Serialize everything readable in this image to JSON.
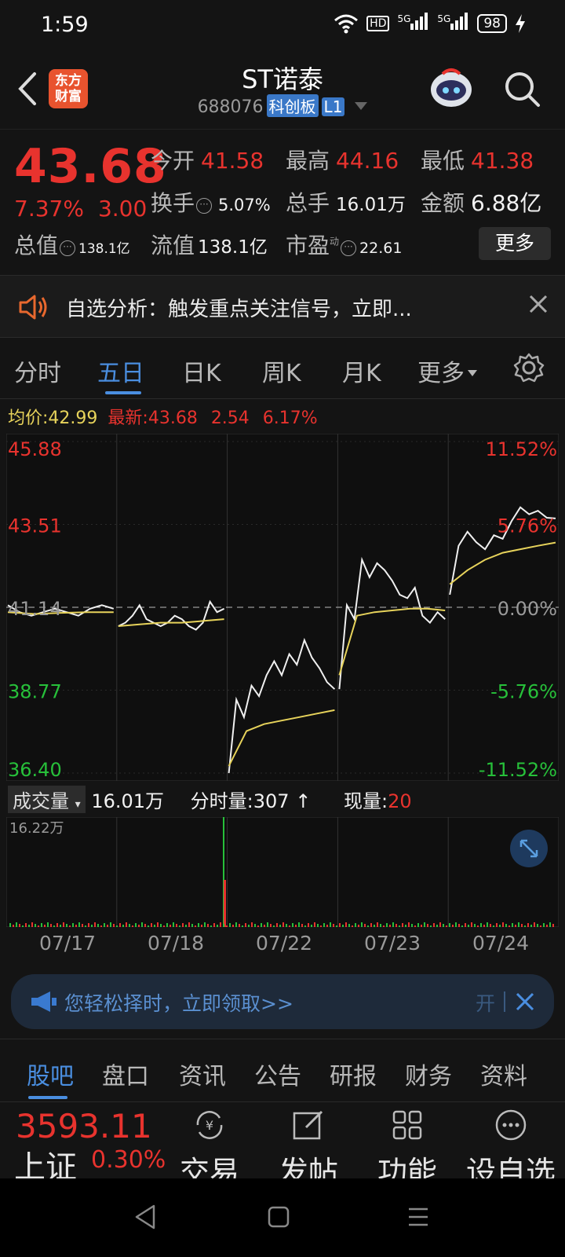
{
  "status_bar": {
    "time": "1:59",
    "hd": "HD",
    "signal1": "5G",
    "signal2": "5G",
    "battery": "98"
  },
  "header": {
    "logo_line1": "东方",
    "logo_line2": "财富",
    "title": "ST诺泰",
    "code": "688076",
    "board_tag": "科创板",
    "level_tag": "L1"
  },
  "quote": {
    "price": "43.68",
    "change_pct": "7.37%",
    "change_amt": "3.00",
    "open_label": "今开",
    "open": "41.58",
    "high_label": "最高",
    "high": "44.16",
    "low_label": "最低",
    "low": "41.38",
    "turnover_label": "换手",
    "turnover": "5.07%",
    "volume_label": "总手",
    "volume": "16.01万",
    "amount_label": "金额",
    "amount": "6.88亿",
    "mktcap_label": "总值",
    "mktcap": "138.1亿",
    "float_label": "流值",
    "float": "138.1亿",
    "pe_label": "市盈",
    "pe_sup": "动",
    "pe": "22.61",
    "more": "更多"
  },
  "notice": {
    "text": "自选分析：触发重点关注信号，立即..."
  },
  "tabs": {
    "items": [
      "分时",
      "五日",
      "日K",
      "周K",
      "月K",
      "更多"
    ],
    "active": "五日"
  },
  "avg_line": {
    "avg_label": "均价:",
    "avg": "42.99",
    "latest_label": "最新:",
    "latest": "43.68",
    "chg": "2.54",
    "pct": "6.17%"
  },
  "chart_data": {
    "type": "line",
    "title": "",
    "y_left_ticks": [
      "45.88",
      "43.51",
      "41.14",
      "38.77",
      "36.40"
    ],
    "y_right_ticks": [
      "11.52%",
      "5.76%",
      "0.00%",
      "-5.76%",
      "-11.52%"
    ],
    "ylim": [
      36.4,
      45.88
    ],
    "prev_close": 41.14,
    "categories": [
      "07/17",
      "07/18",
      "07/22",
      "07/23",
      "07/24"
    ],
    "series": [
      {
        "values": [
          [
            41.2,
            41.0,
            40.9,
            41.0,
            41.1,
            41.0,
            40.9,
            41.1,
            41.2,
            41.1
          ],
          [
            40.6,
            40.7,
            40.9,
            41.2,
            40.8,
            40.7,
            40.6,
            40.7,
            40.9,
            40.8,
            40.6,
            40.5,
            40.7,
            41.3,
            41.0,
            41.1
          ],
          [
            36.4,
            38.5,
            38.0,
            38.9,
            38.6,
            39.2,
            39.6,
            39.2,
            39.8,
            39.5,
            40.2,
            39.7,
            39.4,
            39.0,
            38.8
          ],
          [
            38.8,
            41.2,
            40.8,
            42.5,
            42.0,
            42.4,
            42.2,
            41.9,
            41.5,
            41.4,
            41.7,
            40.9,
            40.7,
            41.0,
            40.8
          ],
          [
            41.5,
            42.9,
            43.3,
            43.0,
            42.8,
            43.2,
            43.1,
            43.6,
            44.0,
            43.8,
            43.9,
            43.7,
            43.68
          ]
        ]
      },
      {
        "values": [
          [
            41.0,
            40.95,
            40.98,
            41.0,
            41.0
          ],
          [
            40.6,
            40.65,
            40.7,
            40.7,
            40.75,
            40.8
          ],
          [
            36.6,
            37.6,
            37.8,
            37.9,
            38.0,
            38.1,
            38.2
          ],
          [
            39.2,
            40.9,
            41.0,
            41.05,
            41.1,
            41.1,
            41.05
          ],
          [
            41.8,
            42.2,
            42.5,
            42.7,
            42.8,
            42.9,
            42.99
          ]
        ]
      }
    ]
  },
  "volume_bar": {
    "selector": "成交量",
    "total": "16.01万",
    "tick_label": "分时量:",
    "tick": "307",
    "now_label": "现量:",
    "now": "20",
    "max_label": "16.22万"
  },
  "banner": {
    "text": "您轻松择时，立即领取>>",
    "open": "开"
  },
  "bottom_tabs": {
    "items": [
      "股吧",
      "盘口",
      "资讯",
      "公告",
      "研报",
      "财务",
      "资料"
    ],
    "active": "股吧"
  },
  "toolbar": {
    "index_value": "3593.11",
    "index_name": "上证",
    "index_pct": "0.30%",
    "items": [
      "交易",
      "发帖",
      "功能",
      "设自选"
    ]
  },
  "colors": {
    "up": "#e8332e",
    "down": "#27c03a",
    "accent": "#4a8ee0",
    "avg": "#e7d35b",
    "bg": "#141414"
  }
}
